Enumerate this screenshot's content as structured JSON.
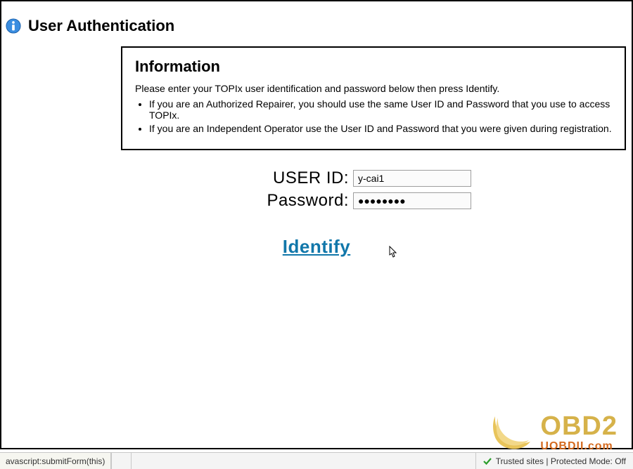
{
  "page_title": "User Authentication",
  "panel": {
    "title": "Information",
    "lead": "Please enter your TOPIx user identification and password below then press Identify.",
    "bullets": [
      "If you are an Authorized Repairer, you should use the same User ID and Password that you use to access TOPIx.",
      "If you are an Independent Operator use the User ID and Password that you were given during registration."
    ]
  },
  "form": {
    "user_id_label": "USER ID:",
    "user_id_value": "y-cai1",
    "password_label": "Password:",
    "password_masked": "●●●●●●●●"
  },
  "identify_label": "Identify",
  "watermark": {
    "line1": "OBD2",
    "line2": "UOBDII.com"
  },
  "statusbar": {
    "left": "avascript:submitForm(this)",
    "right": "Trusted sites | Protected Mode: Off"
  }
}
